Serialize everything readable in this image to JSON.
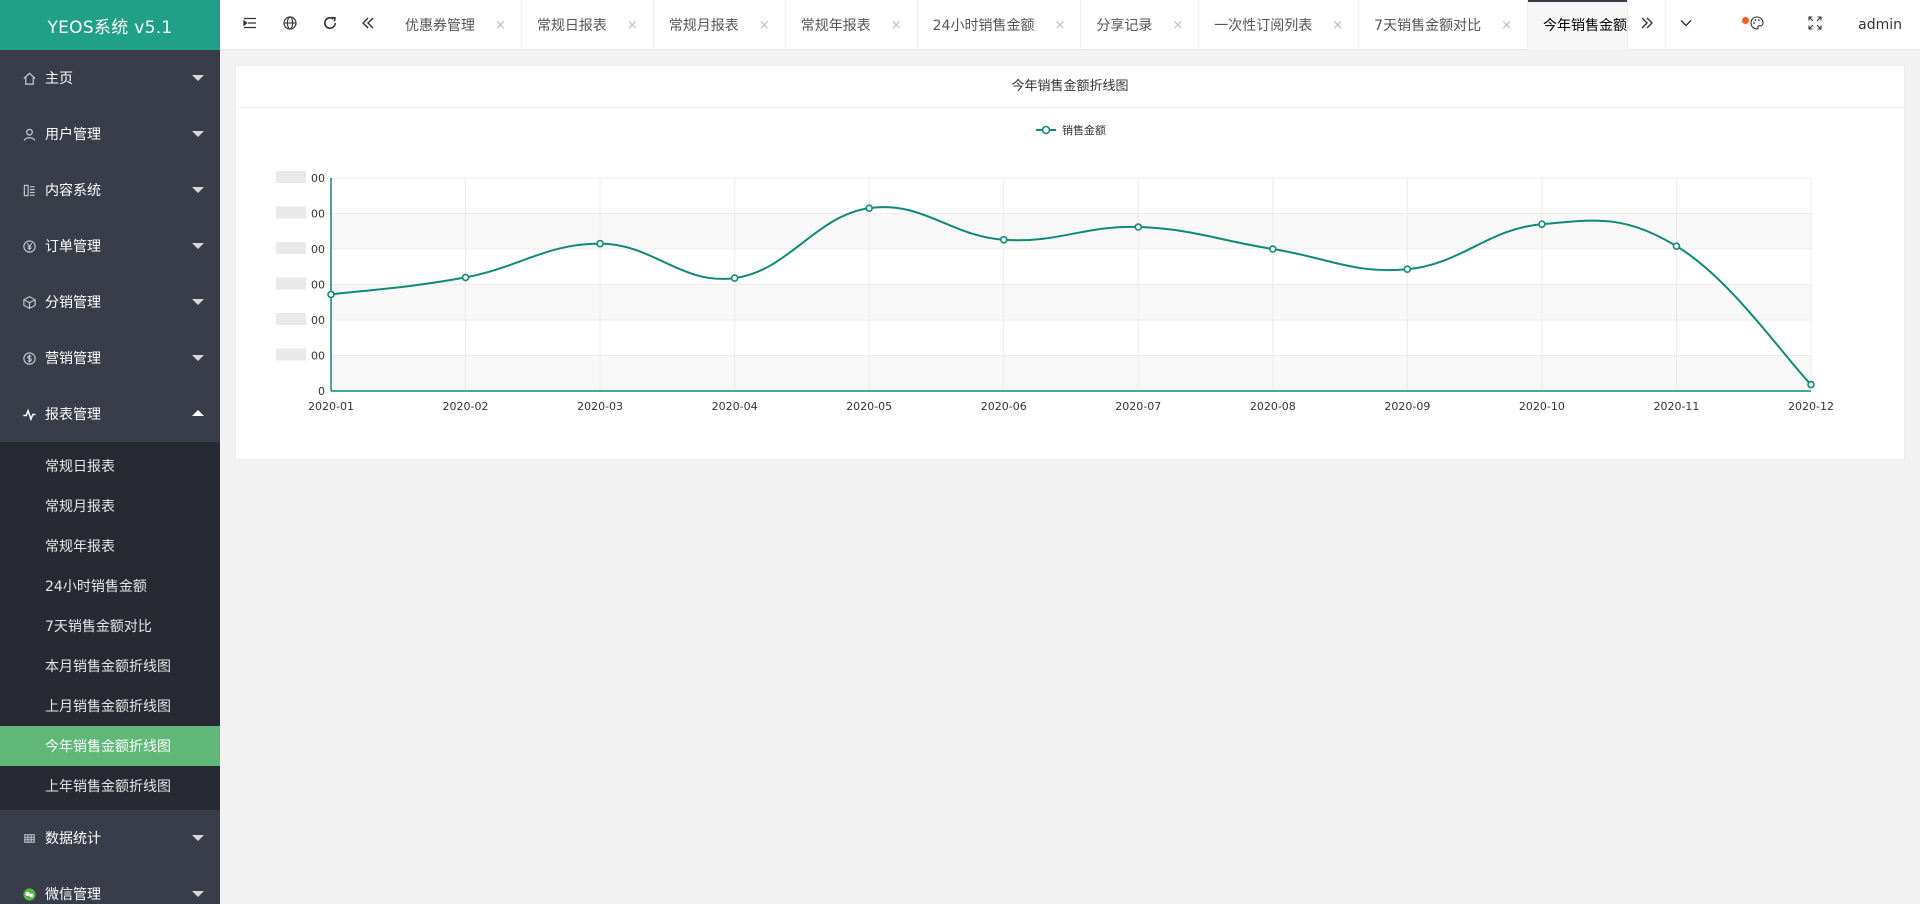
{
  "app": {
    "title": "YEOS系统 v5.1"
  },
  "sidebar": {
    "items": [
      {
        "label": "主页",
        "icon": "home-icon"
      },
      {
        "label": "用户管理",
        "icon": "user-icon"
      },
      {
        "label": "内容系统",
        "icon": "content-icon"
      },
      {
        "label": "订单管理",
        "icon": "yen-icon"
      },
      {
        "label": "分销管理",
        "icon": "cube-icon"
      },
      {
        "label": "营销管理",
        "icon": "dollar-icon"
      },
      {
        "label": "报表管理",
        "icon": "chart-line-icon",
        "expanded": true
      },
      {
        "label": "数据统计",
        "icon": "grid-icon"
      },
      {
        "label": "微信管理",
        "icon": "wechat-icon"
      }
    ],
    "report_sub_items": [
      {
        "label": "常规日报表"
      },
      {
        "label": "常规月报表"
      },
      {
        "label": "常规年报表"
      },
      {
        "label": "24小时销售金额"
      },
      {
        "label": "7天销售金额对比"
      },
      {
        "label": "本月销售金额折线图"
      },
      {
        "label": "上月销售金额折线图"
      },
      {
        "label": "今年销售金额折线图",
        "active": true
      },
      {
        "label": "上年销售金额折线图"
      }
    ]
  },
  "header": {
    "tabs": [
      {
        "label": "优惠券管理"
      },
      {
        "label": "常规日报表"
      },
      {
        "label": "常规月报表"
      },
      {
        "label": "常规年报表"
      },
      {
        "label": "24小时销售金额"
      },
      {
        "label": "分享记录"
      },
      {
        "label": "一次性订阅列表"
      },
      {
        "label": "7天销售金额对比"
      },
      {
        "label": "今年销售金额折线图",
        "active": true
      }
    ],
    "tab_close_glyph": "×",
    "user": "admin"
  },
  "card": {
    "title": "今年销售金额折线图"
  },
  "colors": {
    "sidebar_bg": "#393d49",
    "logo_bg": "#20a087",
    "active_sub": "#5fb878",
    "line": "#0f8a76"
  },
  "chart_data": {
    "type": "line",
    "title": "今年销售金额折线图",
    "legend": [
      "销售金额"
    ],
    "legend_position": "top-center",
    "x": [
      "2020-01",
      "2020-02",
      "2020-03",
      "2020-04",
      "2020-05",
      "2020-06",
      "2020-07",
      "2020-08",
      "2020-09",
      "2020-10",
      "2020-11",
      "2020-12"
    ],
    "series": [
      {
        "name": "销售金额",
        "smooth": true,
        "values": [
          2720,
          3200,
          4150,
          3180,
          5150,
          4260,
          4620,
          4000,
          3430,
          4700,
          4080,
          180
        ]
      }
    ],
    "ylim": [
      0,
      6000
    ],
    "y_ticks": [
      0,
      1000,
      2000,
      3000,
      4000,
      5000,
      6000
    ],
    "y_tick_labels_visible": [
      "0",
      "00",
      "00",
      "00",
      "00",
      "00",
      "00"
    ],
    "grid": true,
    "split_area": true
  }
}
